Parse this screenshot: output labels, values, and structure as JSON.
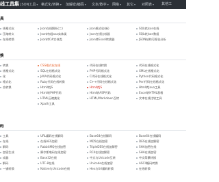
{
  "header": {
    "brand": "线工具集",
    "nav": [
      {
        "label": "JSON工具"
      },
      {
        "label": "格式化/转换"
      },
      {
        "label": "加解密/编码"
      },
      {
        "label": "文本/数字"
      },
      {
        "label": "网络"
      },
      {
        "label": "其它"
      },
      {
        "label": "对照表"
      },
      {
        "label": "其他工"
      }
    ]
  },
  "sections": [
    {
      "title": "具",
      "rows": [
        [
          "线格式化",
          "Json在线解析(二)",
          "Json格式化(新)",
          "SQL转Json在线"
        ],
        [
          "压缩转义",
          "Json转成Java实体类",
          "Json在线比较器",
          "SQL转Json数组"
        ],
        [
          "在线转换",
          "Json转C#实体类",
          "Json转Excel转换器",
          "JSON结构可视化分析"
        ]
      ]
    },
    {
      "title": "换",
      "rows": [
        [
          "转换",
          "CSS格式化在线",
          "代码在线转换",
          "代码在线格式化"
        ],
        [
          "线格式化",
          "SQL在线格式化",
          "PHP代码格式化",
          "XML在线格式化"
        ],
        [
          "化",
          "JAVA代码格式化",
          "C代码在线格式化",
          "Python代码格式化"
        ],
        [
          "格式化",
          "Ruby代码在线转换",
          "C++代码在线格式化",
          "Perl代码在线格式化"
        ],
        [
          "合转换",
          "Html转JS",
          "Html转JS",
          "Html转Java工具"
        ],
        [
          "",
          "Html转PHP代码",
          "Html转ASP代码",
          "Excel转HTML表格"
        ],
        [
          "",
          "HTML压缩美化",
          "HTML/Markdown互转",
          "文本在线比较工具"
        ],
        [
          "",
          "Xpath工具",
          "",
          ""
        ]
      ]
    },
    {
      "title": "码",
      "rows": [
        [
          "工具",
          "URL编码在线解码",
          "Base64在线解码",
          "Base64在线编码"
        ],
        [
          "在线",
          "在线AES加密",
          "MD5在线加密",
          "DES在线加解密"
        ],
        [
          "解码",
          "RabbitMQ在线加密",
          "TripleDES在线加解密",
          "SHA加密在线"
        ],
        [
          "加密生成",
          "摩尔斯电码在线加密",
          "RC4在线加解密",
          "SHA在线加密"
        ],
        [
          "成器",
          "Base32在线",
          "中文与Unicode互转",
          "中文简繁转换"
        ],
        [
          "解码",
          "UTF-8在线",
          "Unicode在线加密",
          "ASCII编码转换"
        ],
        [
          "一键转换",
          "Native与Unicode在线",
          "Hex与Url编码转换",
          "在线转换"
        ]
      ]
    }
  ],
  "highlights": {
    "orange": [
      "CSS格式化在线"
    ],
    "red": [
      "Html转JS"
    ]
  },
  "colors": {
    "topbar": "#2b3036",
    "accent_orange": "#e8632c",
    "accent_red": "#d9332a"
  }
}
